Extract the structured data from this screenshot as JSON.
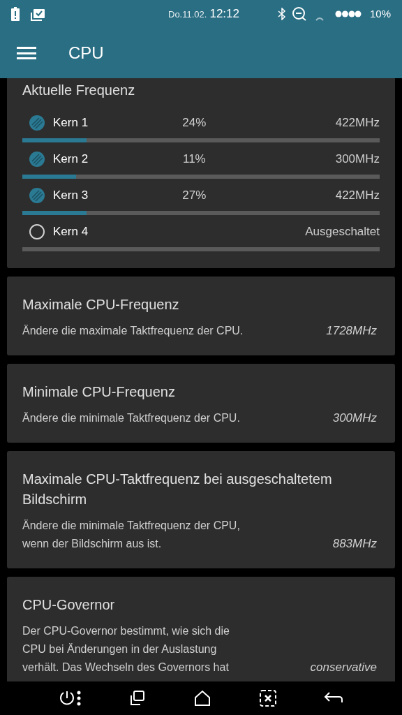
{
  "status_bar": {
    "date": "Do.11.02.",
    "time": "12:12",
    "battery": "10%"
  },
  "app_bar": {
    "title": "CPU"
  },
  "frequency_card": {
    "title": "Aktuelle Frequenz",
    "cores": [
      {
        "name": "Kern 1",
        "on": true,
        "load": "24%",
        "value": "422MHz",
        "level": 0.18
      },
      {
        "name": "Kern 2",
        "on": true,
        "load": "11%",
        "value": "300MHz",
        "level": 0.15
      },
      {
        "name": "Kern 3",
        "on": true,
        "load": "27%",
        "value": "422MHz",
        "level": 0.18
      },
      {
        "name": "Kern 4",
        "on": false,
        "value": "Ausgeschaltet"
      }
    ]
  },
  "settings": [
    {
      "title": "Maximale CPU-Frequenz",
      "description": "Ändere die maximale Taktfrequenz der CPU.",
      "value": "1728MHz"
    },
    {
      "title": "Minimale CPU-Frequenz",
      "description": "Ändere die minimale Taktfrequenz der CPU.",
      "value": "300MHz"
    },
    {
      "title": "Maximale CPU-Taktfrequenz bei ausgeschaltetem Bildschirm",
      "description": "Ändere die minimale Taktfrequenz der CPU, wenn der Bildschirm aus ist.",
      "value": "883MHz"
    },
    {
      "title": "CPU-Governor",
      "description": "Der CPU-Governor bestimmt, wie sich die CPU bei Änderungen in der Auslastung verhält. Das Wechseln des Governors hat",
      "value": "conservative"
    }
  ]
}
